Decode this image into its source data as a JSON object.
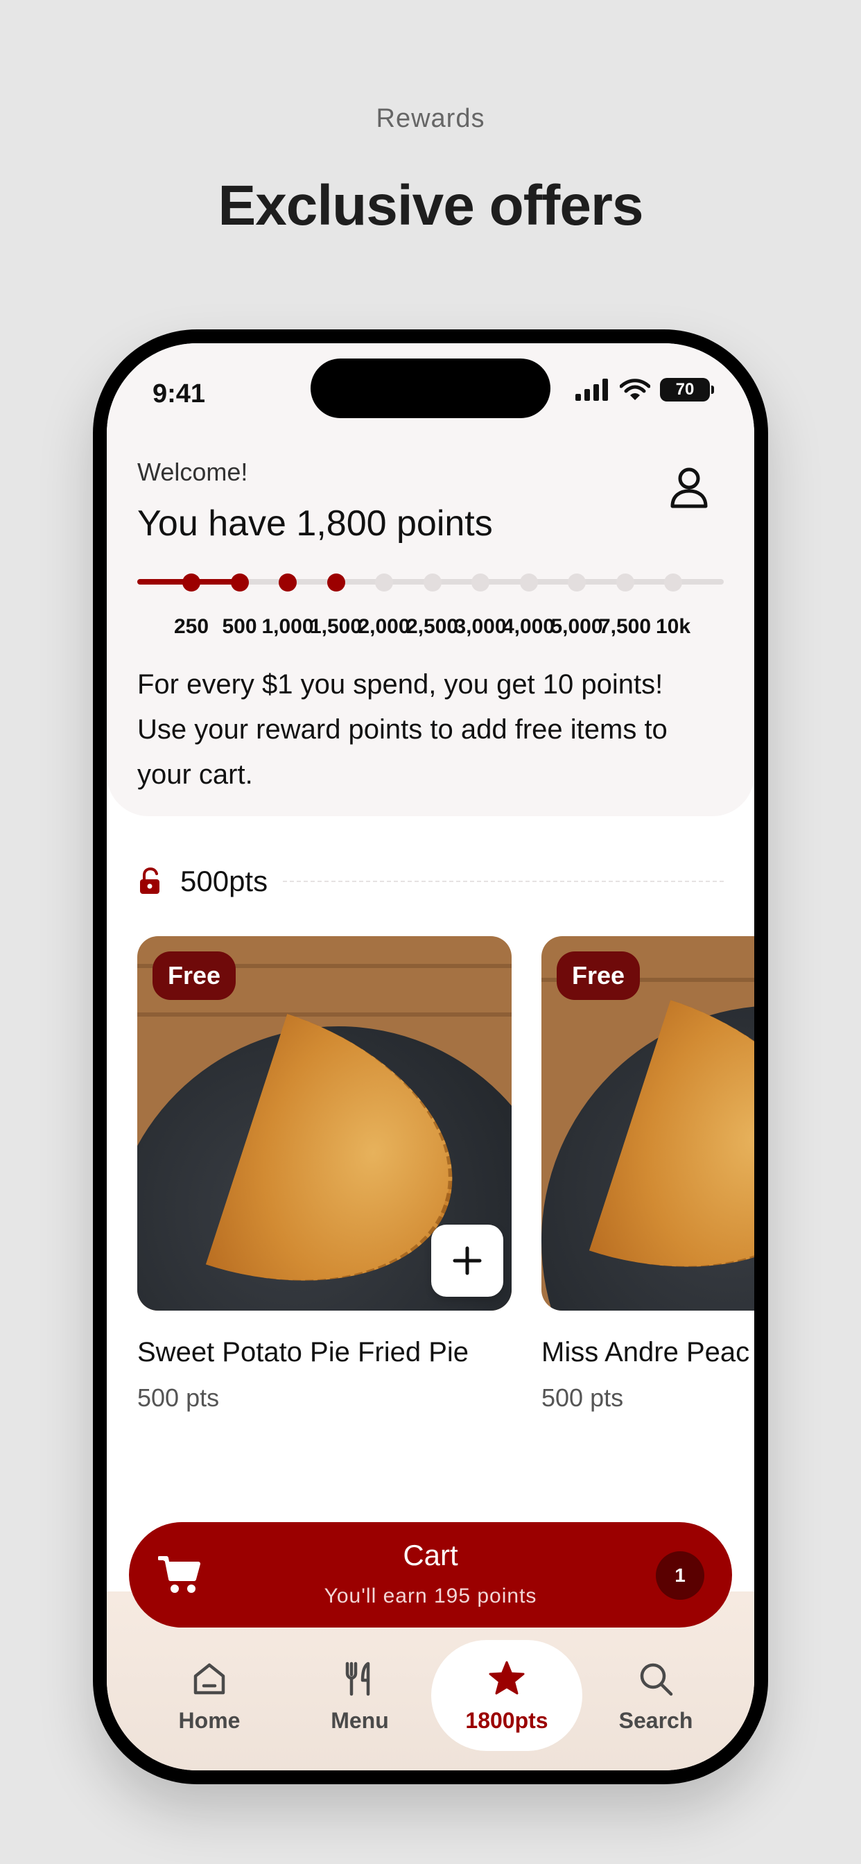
{
  "header": {
    "subtitle": "Rewards",
    "title": "Exclusive offers"
  },
  "status_bar": {
    "time": "9:41",
    "battery": "70"
  },
  "rewards": {
    "welcome": "Welcome!",
    "points_title": "You have 1,800 points",
    "progress_fraction": 0.18,
    "milestones": [
      "250",
      "500",
      "1,000",
      "1,500",
      "2,000",
      "2,500",
      "3,000",
      "4,000",
      "5,000",
      "7,500",
      "10k"
    ],
    "achieved_count": 4,
    "info": "For every $1 you spend, you get 10 points! Use your reward points to add free items to your cart."
  },
  "section": {
    "label": "500pts"
  },
  "cards": [
    {
      "badge": "Free",
      "name": "Sweet Potato Pie Fried Pie",
      "points": "500 pts"
    },
    {
      "badge": "Free",
      "name": "Miss Andre Peac",
      "points": "500 pts"
    }
  ],
  "cart": {
    "label": "Cart",
    "subtitle": "You'll earn 195 points",
    "count": "1"
  },
  "tabs": [
    {
      "label": "Home",
      "icon": "home-icon"
    },
    {
      "label": "Menu",
      "icon": "utensils-icon"
    },
    {
      "label": "1800pts",
      "icon": "star-icon"
    },
    {
      "label": "Search",
      "icon": "search-icon"
    }
  ],
  "colors": {
    "accent": "#9b0000",
    "badge": "#6f0a0a",
    "background": "#e6e6e6"
  }
}
